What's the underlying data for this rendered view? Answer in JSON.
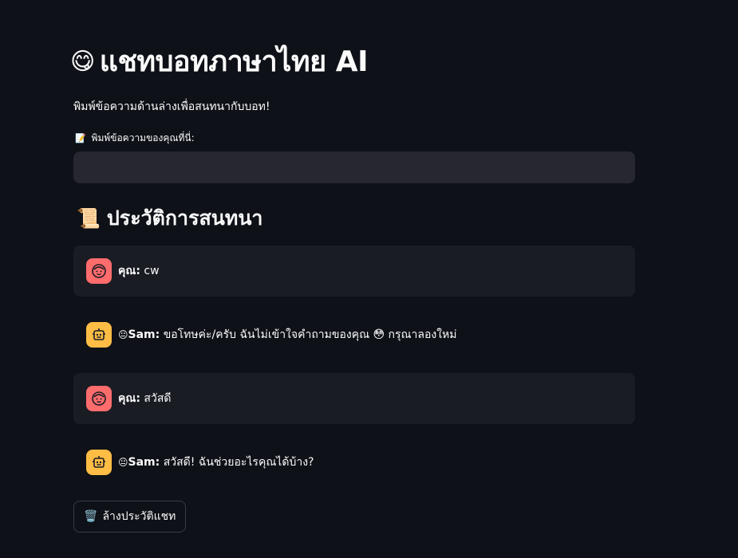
{
  "header": {
    "title_emoji": "😋",
    "title": "แชทบอทภาษาไทย AI",
    "subtitle": "พิมพ์ข้อความด้านล่างเพื่อสนทนากับบอท!"
  },
  "input": {
    "label_icon": "📝",
    "label": "พิมพ์ข้อความของคุณที่นี่:",
    "value": "",
    "placeholder": ""
  },
  "history": {
    "title_emoji": "📜",
    "title": "ประวัติการสนทนา",
    "messages": [
      {
        "role": "user",
        "avatar_icon": "user-face-icon",
        "speaker": "คุณ:",
        "text": "cw"
      },
      {
        "role": "bot",
        "avatar_icon": "robot-icon",
        "speaker_emoji": "😐",
        "speaker": "Sam:",
        "text": "ขอโทษค่ะ/ครับ ฉันไม่เข้าใจคำถามของคุณ 😳 กรุณาลองใหม่"
      },
      {
        "role": "user",
        "avatar_icon": "user-face-icon",
        "speaker": "คุณ:",
        "text": "สวัสดี"
      },
      {
        "role": "bot",
        "avatar_icon": "robot-icon",
        "speaker_emoji": "😐",
        "speaker": "Sam:",
        "text": "สวัสดี! ฉันช่วยอะไรคุณได้บ้าง?"
      }
    ]
  },
  "clear_button": {
    "icon": "🗑️",
    "label": "ล้างประวัติแชท"
  },
  "colors": {
    "background": "#0e1117",
    "input_bg": "#262730",
    "user_msg_bg": "#1a1c24",
    "user_avatar": "#ff6c6c",
    "bot_avatar": "#ffbd45"
  }
}
